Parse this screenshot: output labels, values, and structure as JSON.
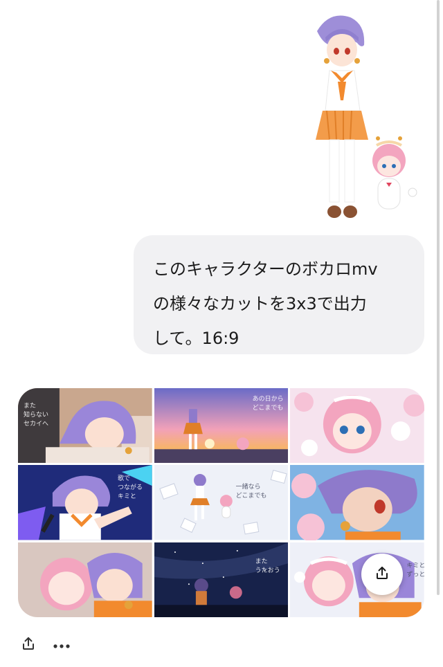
{
  "conversation": {
    "user_message": "このキャラクターのボカロmv\nの様々なカットを3x3で出力\nして。16:9"
  },
  "result_image": {
    "captions": {
      "cell1": "また\n知らない\nセカイへ",
      "cell2": "あの日から\nどこまでも",
      "cell4": "歌で\nつながる\nキミと",
      "cell5": "一緒なら\nどこまでも",
      "cell8": "また\nうたおう",
      "cell9": "キミと\nずっと"
    }
  },
  "icons": {
    "share_overlay": "share-icon",
    "bottom_share": "share-icon",
    "more": "more-horizontal-icon"
  }
}
